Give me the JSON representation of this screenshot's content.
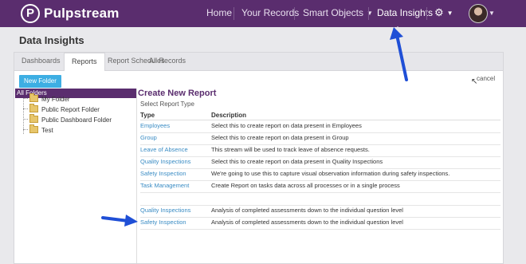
{
  "nav": {
    "logo_letter": "P",
    "brand": "Pulpstream",
    "items": [
      {
        "label": "Home"
      },
      {
        "label": "Your Records"
      },
      {
        "label": "Smart Objects"
      },
      {
        "label": "Data Insights"
      }
    ],
    "gear_icon": "gear-icon"
  },
  "page_title": "Data Insights",
  "tabs": [
    {
      "label": "Dashboards"
    },
    {
      "label": "Reports",
      "active": true
    },
    {
      "label": "Report Schedules"
    },
    {
      "label": "All Records"
    }
  ],
  "toolbar": {
    "new_folder_label": "New Folder",
    "cancel_label": "cancel"
  },
  "sidebar": {
    "root_label": "All Folders",
    "folders": [
      {
        "label": "My Folder"
      },
      {
        "label": "Public Report Folder"
      },
      {
        "label": "Public Dashboard Folder"
      },
      {
        "label": "Test"
      }
    ]
  },
  "report": {
    "title": "Create New Report",
    "subtitle": "Select Report Type",
    "columns": {
      "type": "Type",
      "description": "Description"
    },
    "rows": [
      {
        "type": "Employees",
        "description": "Select this to create report on data present in Employees"
      },
      {
        "type": "Group",
        "description": "Select this to create report on data present in Group"
      },
      {
        "type": "Leave of Absence",
        "description": "This stream will be used to track leave of absence requests."
      },
      {
        "type": "Quality Inspections",
        "description": "Select this to create report on data present in Quality Inspections"
      },
      {
        "type": "Safety Inspection",
        "description": "We're going to use this to capture visual observation information during safety inspections."
      },
      {
        "type": "Task Management",
        "description": "Create Report on tasks data across all processes or in a single process"
      },
      {
        "type": "",
        "description": ""
      },
      {
        "type": "Quality Inspections",
        "description": "Analysis of completed assessments down to the individual question level"
      },
      {
        "type": "Safety Inspection",
        "description": "Analysis of completed assessments down to the individual question level"
      }
    ]
  },
  "colors": {
    "brand_purple": "#5a2d6e",
    "link_blue": "#3a8cc4",
    "button_blue": "#3daee3",
    "annotation_arrow": "#1f4fd6"
  }
}
